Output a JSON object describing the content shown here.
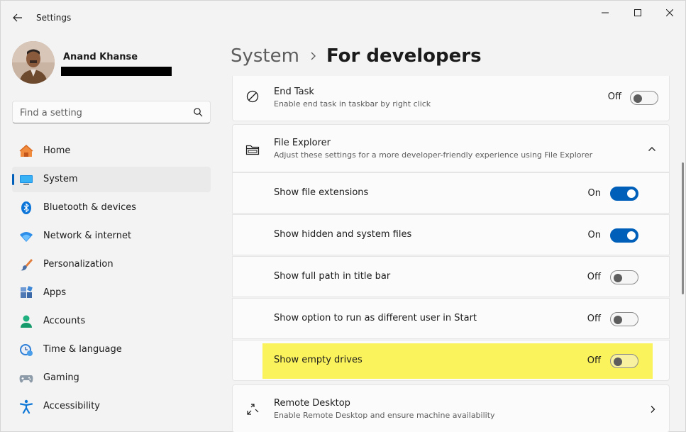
{
  "window": {
    "title": "Settings"
  },
  "user": {
    "name": "Anand Khanse"
  },
  "search": {
    "placeholder": "Find a setting"
  },
  "nav": [
    {
      "label": "Home",
      "icon": "home-icon"
    },
    {
      "label": "System",
      "icon": "monitor-icon",
      "selected": true
    },
    {
      "label": "Bluetooth & devices",
      "icon": "bluetooth-icon"
    },
    {
      "label": "Network & internet",
      "icon": "wifi-icon"
    },
    {
      "label": "Personalization",
      "icon": "brush-icon"
    },
    {
      "label": "Apps",
      "icon": "apps-icon"
    },
    {
      "label": "Accounts",
      "icon": "person-icon"
    },
    {
      "label": "Time & language",
      "icon": "globe-clock-icon"
    },
    {
      "label": "Gaming",
      "icon": "gamepad-icon"
    },
    {
      "label": "Accessibility",
      "icon": "accessibility-icon"
    }
  ],
  "breadcrumb": {
    "parent": "System",
    "current": "For developers"
  },
  "end_task": {
    "title": "End Task",
    "description": "Enable end task in taskbar by right click",
    "state": "Off"
  },
  "file_explorer": {
    "title": "File Explorer",
    "description": "Adjust these settings for a more developer-friendly experience using File Explorer",
    "items": [
      {
        "label": "Show file extensions",
        "state": "On"
      },
      {
        "label": "Show hidden and system files",
        "state": "On"
      },
      {
        "label": "Show full path in title bar",
        "state": "Off"
      },
      {
        "label": "Show option to run as different user in Start",
        "state": "Off"
      },
      {
        "label": "Show empty drives",
        "state": "Off",
        "highlighted": true
      }
    ]
  },
  "remote_desktop": {
    "title": "Remote Desktop",
    "description": "Enable Remote Desktop and ensure machine availability"
  },
  "colors": {
    "accent": "#005fb8",
    "highlight": "#fbf35c",
    "background": "#f3f3f3",
    "card": "#fbfbfb"
  }
}
